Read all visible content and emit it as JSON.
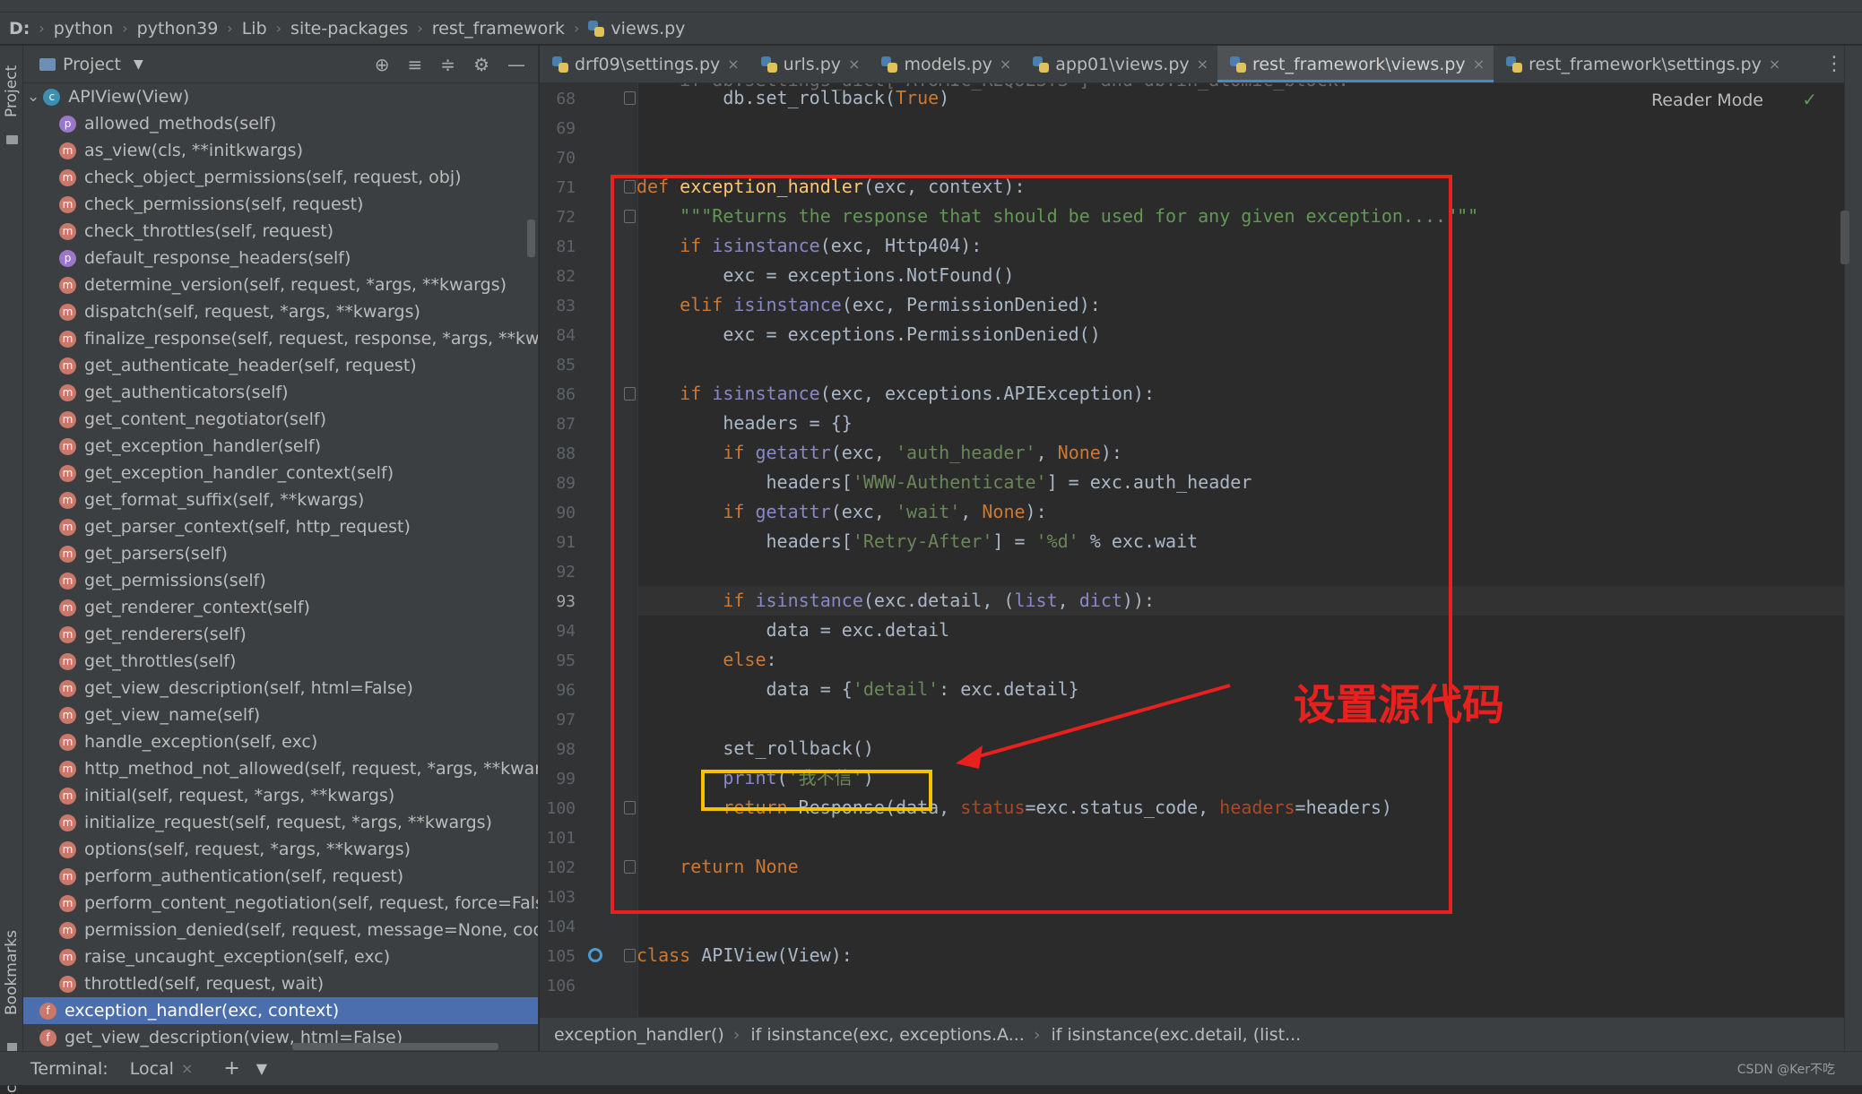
{
  "breadcrumb": [
    "D:",
    "python",
    "python39",
    "Lib",
    "site-packages",
    "rest_framework",
    "views.py"
  ],
  "left_strip": {
    "project": "Project",
    "bookmarks": "Bookmarks",
    "structure": "cture"
  },
  "project_panel": {
    "title": "Project",
    "tree": [
      {
        "label": "APIView(View)",
        "badge": "c",
        "indent": 0,
        "arrow": true
      },
      {
        "label": "allowed_methods(self)",
        "badge": "p"
      },
      {
        "label": "as_view(cls, **initkwargs)",
        "badge": "m"
      },
      {
        "label": "check_object_permissions(self, request, obj)",
        "badge": "m"
      },
      {
        "label": "check_permissions(self, request)",
        "badge": "m"
      },
      {
        "label": "check_throttles(self, request)",
        "badge": "m"
      },
      {
        "label": "default_response_headers(self)",
        "badge": "p"
      },
      {
        "label": "determine_version(self, request, *args, **kwargs)",
        "badge": "m"
      },
      {
        "label": "dispatch(self, request, *args, **kwargs)",
        "badge": "m"
      },
      {
        "label": "finalize_response(self, request, response, *args, **kwargs)",
        "badge": "m"
      },
      {
        "label": "get_authenticate_header(self, request)",
        "badge": "m"
      },
      {
        "label": "get_authenticators(self)",
        "badge": "m"
      },
      {
        "label": "get_content_negotiator(self)",
        "badge": "m"
      },
      {
        "label": "get_exception_handler(self)",
        "badge": "m"
      },
      {
        "label": "get_exception_handler_context(self)",
        "badge": "m"
      },
      {
        "label": "get_format_suffix(self, **kwargs)",
        "badge": "m"
      },
      {
        "label": "get_parser_context(self, http_request)",
        "badge": "m"
      },
      {
        "label": "get_parsers(self)",
        "badge": "m"
      },
      {
        "label": "get_permissions(self)",
        "badge": "m"
      },
      {
        "label": "get_renderer_context(self)",
        "badge": "m"
      },
      {
        "label": "get_renderers(self)",
        "badge": "m"
      },
      {
        "label": "get_throttles(self)",
        "badge": "m"
      },
      {
        "label": "get_view_description(self, html=False)",
        "badge": "m"
      },
      {
        "label": "get_view_name(self)",
        "badge": "m"
      },
      {
        "label": "handle_exception(self, exc)",
        "badge": "m"
      },
      {
        "label": "http_method_not_allowed(self, request, *args, **kwargs)",
        "badge": "m"
      },
      {
        "label": "initial(self, request, *args, **kwargs)",
        "badge": "m"
      },
      {
        "label": "initialize_request(self, request, *args, **kwargs)",
        "badge": "m"
      },
      {
        "label": "options(self, request, *args, **kwargs)",
        "badge": "m"
      },
      {
        "label": "perform_authentication(self, request)",
        "badge": "m"
      },
      {
        "label": "perform_content_negotiation(self, request, force=False)",
        "badge": "m"
      },
      {
        "label": "permission_denied(self, request, message=None, code=N",
        "badge": "m"
      },
      {
        "label": "raise_uncaught_exception(self, exc)",
        "badge": "m"
      },
      {
        "label": "throttled(self, request, wait)",
        "badge": "m"
      },
      {
        "label": "exception_handler(exc, context)",
        "badge": "f",
        "indent": 0,
        "selected": true
      },
      {
        "label": "get_view_description(view, html=False)",
        "badge": "f",
        "indent": 0
      }
    ]
  },
  "tabs": [
    {
      "label": "drf09\\settings.py",
      "active": false
    },
    {
      "label": "urls.py",
      "active": false
    },
    {
      "label": "models.py",
      "active": false
    },
    {
      "label": "app01\\views.py",
      "active": false
    },
    {
      "label": "rest_framework\\views.py",
      "active": true
    },
    {
      "label": "rest_framework\\settings.py",
      "active": false
    }
  ],
  "editor": {
    "reader_mode": "Reader Mode",
    "top_partial": "    if db.settings_dict['ATOMIC_REQUESTS'] and db.in_atomic_block:",
    "current_line": "93",
    "lines": [
      {
        "n": "68",
        "html": "        db.set_rollback(<kw>True</kw>)"
      },
      {
        "n": "69",
        "html": ""
      },
      {
        "n": "70",
        "html": ""
      },
      {
        "n": "71",
        "html": "<kw>def</kw> <fn>exception_handler</fn>(exc, context):"
      },
      {
        "n": "72",
        "html": "    <doc>\"\"\"Returns the response that should be used for any given exception....\"\"\"</doc>"
      },
      {
        "n": "81",
        "html": "    <kw>if</kw> <bi>isinstance</bi>(exc, Http404):"
      },
      {
        "n": "82",
        "html": "        exc = exceptions.NotFound()"
      },
      {
        "n": "83",
        "html": "    <kw>elif</kw> <bi>isinstance</bi>(exc, PermissionDenied):"
      },
      {
        "n": "84",
        "html": "        exc = exceptions.PermissionDenied()"
      },
      {
        "n": "85",
        "html": ""
      },
      {
        "n": "86",
        "html": "    <kw>if</kw> <bi>isinstance</bi>(exc, exceptions.APIException):"
      },
      {
        "n": "87",
        "html": "        headers = {}"
      },
      {
        "n": "88",
        "html": "        <kw>if</kw> <bi>getattr</bi>(exc, <str>'auth_header'</str>, <kw>None</kw>):"
      },
      {
        "n": "89",
        "html": "            headers[<str>'WWW-Authenticate'</str>] = exc.auth_header"
      },
      {
        "n": "90",
        "html": "        <kw>if</kw> <bi>getattr</bi>(exc, <str>'wait'</str>, <kw>None</kw>):"
      },
      {
        "n": "91",
        "html": "            headers[<str>'Retry-After'</str>] = <str>'%d'</str> % exc.wait"
      },
      {
        "n": "92",
        "html": ""
      },
      {
        "n": "93",
        "html": "        <kw>if</kw> <bi>isinstance</bi>(exc.detail, (<bi>list</bi>, <bi>dict</bi>)):"
      },
      {
        "n": "94",
        "html": "            data = exc.detail"
      },
      {
        "n": "95",
        "html": "        <kw>else</kw>:"
      },
      {
        "n": "96",
        "html": "            data = {<str>'detail'</str>: exc.detail}"
      },
      {
        "n": "97",
        "html": ""
      },
      {
        "n": "98",
        "html": "        set_rollback()"
      },
      {
        "n": "99",
        "html": "        <bi>print</bi>(<str>'我不信'</str>)"
      },
      {
        "n": "100",
        "html": "        <kw>return</kw> Response(data, <kwa>status</kwa>=exc.status_code, <kwa>headers</kwa>=headers)"
      },
      {
        "n": "101",
        "html": ""
      },
      {
        "n": "102",
        "html": "    <kw>return</kw> <kw>None</kw>"
      },
      {
        "n": "103",
        "html": ""
      },
      {
        "n": "104",
        "html": ""
      },
      {
        "n": "105",
        "html": "<kw>class</kw> APIView(View):"
      },
      {
        "n": "106",
        "html": ""
      }
    ]
  },
  "annotation": {
    "text": "设置源代码"
  },
  "status_crumbs": [
    "exception_handler()",
    "if isinstance(exc, exceptions.A...",
    "if isinstance(exc.detail, (list..."
  ],
  "terminal": {
    "label": "Terminal:",
    "tab": "Local"
  },
  "watermark": "CSDN @Ker不吃"
}
